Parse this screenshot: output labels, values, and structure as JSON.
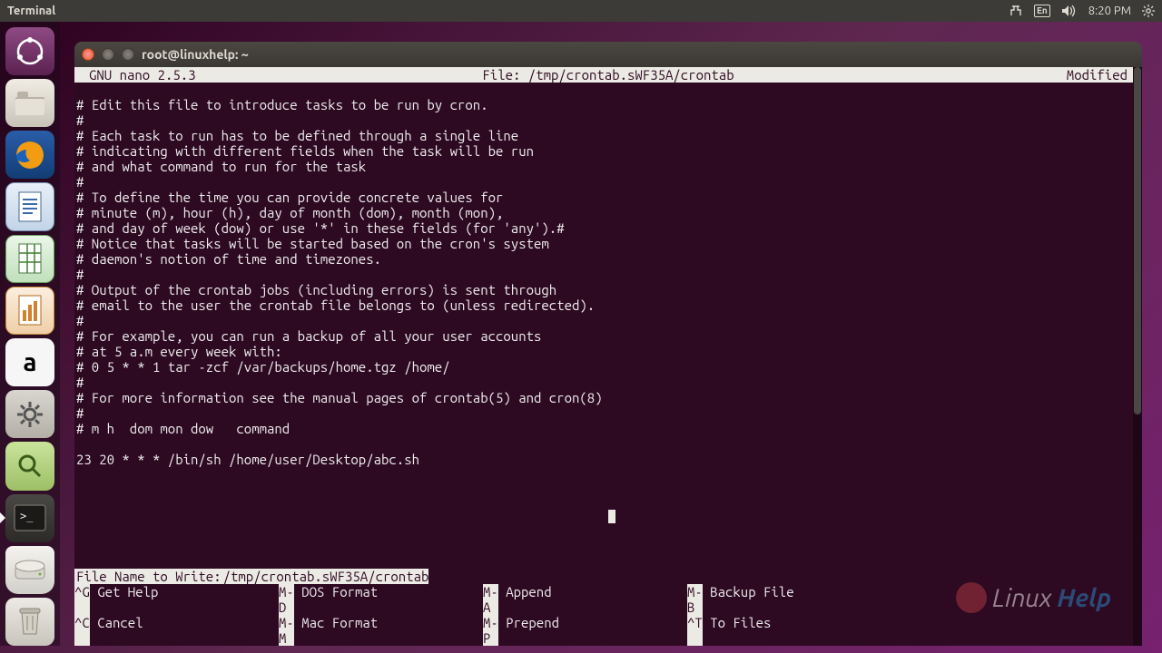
{
  "menubar": {
    "title": "Terminal",
    "lang": "En",
    "time": "8:20 PM"
  },
  "launcher": {
    "amazon_label": "a"
  },
  "window": {
    "title": "root@linuxhelp: ~"
  },
  "nano": {
    "version": "GNU nano 2.5.3",
    "file_label": "File: /tmp/crontab.sWF35A/crontab",
    "status": "Modified",
    "lines": [
      "# Edit this file to introduce tasks to be run by cron.",
      "#",
      "# Each task to run has to be defined through a single line",
      "# indicating with different fields when the task will be run",
      "# and what command to run for the task",
      "#",
      "# To define the time you can provide concrete values for",
      "# minute (m), hour (h), day of month (dom), month (mon),",
      "# and day of week (dow) or use '*' in these fields (for 'any').#",
      "# Notice that tasks will be started based on the cron's system",
      "# daemon's notion of time and timezones.",
      "#",
      "# Output of the crontab jobs (including errors) is sent through",
      "# email to the user the crontab file belongs to (unless redirected).",
      "#",
      "# For example, you can run a backup of all your user accounts",
      "# at 5 a.m every week with:",
      "# 0 5 * * 1 tar -zcf /var/backups/home.tgz /home/",
      "#",
      "# For more information see the manual pages of crontab(5) and cron(8)",
      "#",
      "# m h  dom mon dow   command",
      "",
      "23 20 * * * /bin/sh /home/user/Desktop/abc.sh"
    ],
    "write_prompt_label": "File Name to Write: ",
    "write_prompt_value": "/tmp/crontab.sWF35A/crontab",
    "shortcuts_row1": [
      {
        "key": "^G",
        "label": "Get Help"
      },
      {
        "key": "M-D",
        "label": "DOS Format"
      },
      {
        "key": "M-A",
        "label": "Append"
      },
      {
        "key": "M-B",
        "label": "Backup File"
      }
    ],
    "shortcuts_row2": [
      {
        "key": "^C",
        "label": "Cancel"
      },
      {
        "key": "M-M",
        "label": "Mac Format"
      },
      {
        "key": "M-P",
        "label": "Prepend"
      },
      {
        "key": "^T",
        "label": "To Files"
      }
    ]
  },
  "watermark": {
    "text_a": "Linux",
    "text_b": "Help"
  }
}
